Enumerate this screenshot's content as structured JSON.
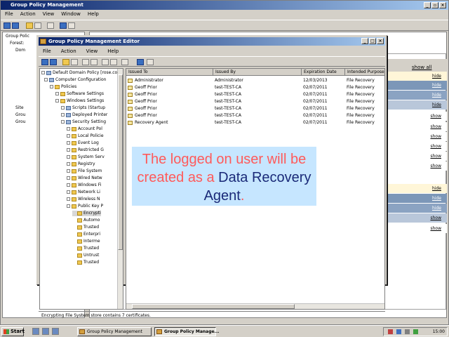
{
  "gpm": {
    "title": "Group Policy Management",
    "menu": [
      "File",
      "Action",
      "View",
      "Window",
      "Help"
    ],
    "tree": [
      "Group Polic",
      "Forest:",
      "Dom",
      "",
      "",
      "",
      "",
      "",
      "",
      "",
      "Site",
      "Grou",
      "Grou"
    ],
    "show_all": "show all",
    "side_links": [
      "hide",
      "hide",
      "hide",
      "hide",
      "show",
      "show",
      "show",
      "show",
      "show",
      "show",
      "hide",
      "hide",
      "hide",
      "show",
      "show"
    ]
  },
  "gpme": {
    "title": "Group Policy Management Editor",
    "menu": [
      "File",
      "Action",
      "View",
      "Help"
    ],
    "tree": [
      {
        "label": "Default Domain Policy [rose.com]",
        "kind": "pol"
      },
      {
        "label": "Computer Configuration",
        "kind": "pol"
      },
      {
        "label": "Policies",
        "kind": "folder"
      },
      {
        "label": "Software Settings",
        "kind": "folder"
      },
      {
        "label": "Windows Settings",
        "kind": "folder"
      },
      {
        "label": "Scripts (Startup",
        "kind": "pol"
      },
      {
        "label": "Deployed Printer",
        "kind": "pol"
      },
      {
        "label": "Security Setting",
        "kind": "pol"
      },
      {
        "label": "Account Pol",
        "kind": "folder"
      },
      {
        "label": "Local Policie",
        "kind": "folder"
      },
      {
        "label": "Event Log",
        "kind": "folder"
      },
      {
        "label": "Restricted G",
        "kind": "folder"
      },
      {
        "label": "System Serv",
        "kind": "folder"
      },
      {
        "label": "Registry",
        "kind": "folder"
      },
      {
        "label": "File System",
        "kind": "folder"
      },
      {
        "label": "Wired Netw",
        "kind": "folder"
      },
      {
        "label": "Windows Fi",
        "kind": "folder"
      },
      {
        "label": "Network Li",
        "kind": "folder"
      },
      {
        "label": "Wireless N",
        "kind": "folder"
      },
      {
        "label": "Public Key P",
        "kind": "folder"
      },
      {
        "label": "Encrypti",
        "kind": "folder"
      },
      {
        "label": "Automo",
        "kind": "folder"
      },
      {
        "label": "Trusted",
        "kind": "folder"
      },
      {
        "label": "Enterpri",
        "kind": "folder"
      },
      {
        "label": "Interme",
        "kind": "folder"
      },
      {
        "label": "Trusted",
        "kind": "folder"
      },
      {
        "label": "Untrust",
        "kind": "folder"
      },
      {
        "label": "Trusted",
        "kind": "folder"
      }
    ],
    "columns": [
      "Issued To",
      "Issued By",
      "Expiration Date",
      "Intended Purpose"
    ],
    "rows": [
      [
        "Administrator",
        "Administrator",
        "12/03/2013",
        "File Recovery"
      ],
      [
        "Geoff Prior",
        "test-TEST-CA",
        "02/07/2011",
        "File Recovery"
      ],
      [
        "Geoff Prior",
        "test-TEST-CA",
        "02/07/2011",
        "File Recovery"
      ],
      [
        "Geoff Prior",
        "test-TEST-CA",
        "02/07/2011",
        "File Recovery"
      ],
      [
        "Geoff Prior",
        "test-TEST-CA",
        "02/07/2011",
        "File Recovery"
      ],
      [
        "Geoff Prior",
        "test-TEST-CA",
        "02/07/2011",
        "File Recovery"
      ],
      [
        "Recovery Agent",
        "test-TEST-CA",
        "02/07/2011",
        "File Recovery"
      ]
    ],
    "status": "Encrypting File System store contains 7 certificates."
  },
  "caption": {
    "part1": "The logged on user will be created as a ",
    "part2": "Data Recovery Agent",
    "part3": "."
  },
  "taskbar": {
    "start": "Start",
    "tasks": [
      "Group Policy Management",
      "Group Policy Manage..."
    ],
    "clock": "15:00"
  }
}
